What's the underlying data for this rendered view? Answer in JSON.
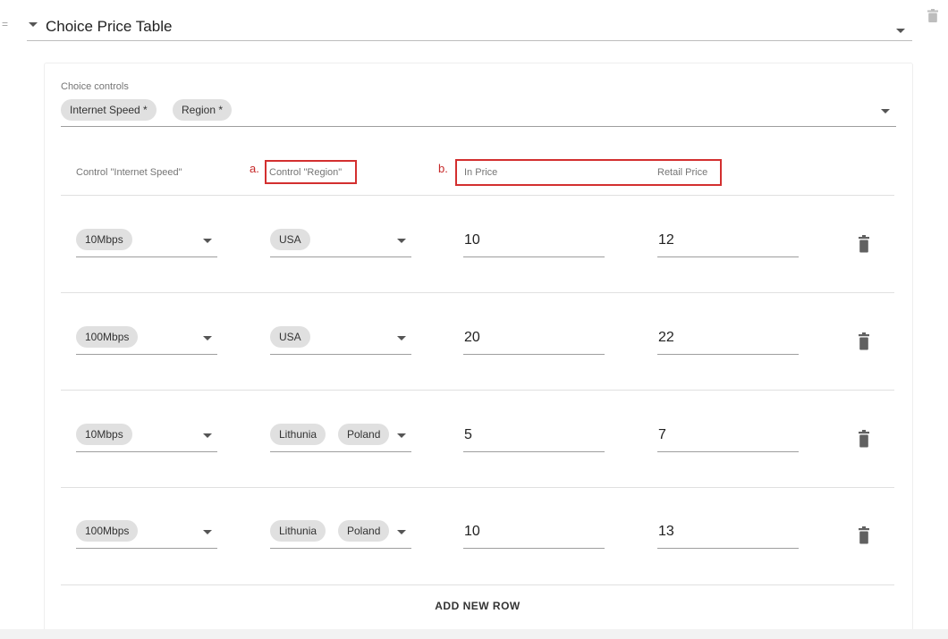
{
  "header": {
    "drag_handle": "=",
    "title": "Choice Price Table"
  },
  "choice_controls": {
    "label": "Choice controls",
    "chips": [
      "Internet Speed *",
      "Region *"
    ]
  },
  "columns": {
    "speed": "Control \"Internet Speed\"",
    "region": "Control \"Region\"",
    "in_price": "In Price",
    "retail_price": "Retail Price"
  },
  "annotations": {
    "a": "a.",
    "b": "b."
  },
  "rows": [
    {
      "speed": "10Mbps",
      "regions": [
        "USA"
      ],
      "in_price": "10",
      "retail_price": "12"
    },
    {
      "speed": "100Mbps",
      "regions": [
        "USA"
      ],
      "in_price": "20",
      "retail_price": "22"
    },
    {
      "speed": "10Mbps",
      "regions": [
        "Lithunia",
        "Poland"
      ],
      "in_price": "5",
      "retail_price": "7"
    },
    {
      "speed": "100Mbps",
      "regions": [
        "Lithunia",
        "Poland"
      ],
      "in_price": "10",
      "retail_price": "13"
    }
  ],
  "add_row_label": "ADD NEW ROW",
  "icons": {
    "trash": "trash-icon",
    "caret": "caret-down-icon",
    "drag": "drag-handle-icon"
  },
  "colors": {
    "annotation": "#d32f2f",
    "chip_bg": "#e0e0e0",
    "icon": "#616161"
  }
}
